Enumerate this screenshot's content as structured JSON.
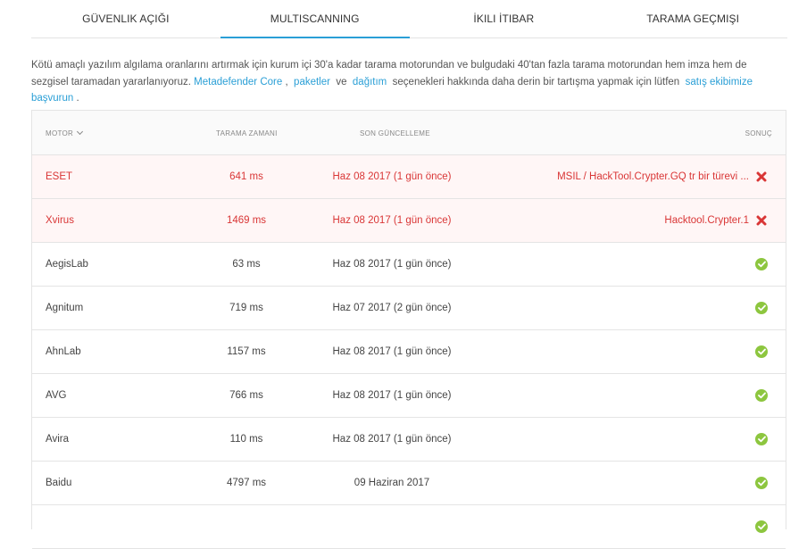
{
  "tabs": [
    {
      "label": "GÜVENLIK AÇIĞI"
    },
    {
      "label": "MULTISCANNING",
      "active": true
    },
    {
      "label": "İKILI İTIBAR"
    },
    {
      "label": "TARAMA GEÇMIŞI"
    }
  ],
  "intro": {
    "text_before": "Kötü amaçlı yazılım algılama oranlarını artırmak için kurum içi 30'a kadar tarama motorundan ve bulgudaki 40'tan fazla tarama motorundan hem imza hem de sezgisel taramadan yararlanıyoruz. ",
    "link_core": "Metadefender Core",
    "sep1": " ,  ",
    "link_packages": "paketler",
    "sep2": "  ve  ",
    "link_deploy": "dağıtım",
    "text_middle": "  seçenekleri hakkında daha derin bir tartışma yapmak için lütfen  ",
    "link_sales": "satış ekibimize başvurun",
    "text_end": " ."
  },
  "table": {
    "headers": {
      "motor": "MOTOR",
      "time": "TARAMA ZAMANI",
      "updated": "SON GÜNCELLEME",
      "result": "SONUÇ"
    },
    "rows": [
      {
        "motor": "ESET",
        "time": "641 ms",
        "updated": "Haz 08 2017 (1 gün önce)",
        "result": "MSIL / HackTool.Crypter.GQ tr bir türevi ...",
        "status": "infected"
      },
      {
        "motor": "Xvirus",
        "time": "1469 ms",
        "updated": "Haz 08 2017 (1 gün önce)",
        "result": "Hacktool.Crypter.1",
        "status": "infected"
      },
      {
        "motor": "AegisLab",
        "time": "63 ms",
        "updated": "Haz 08 2017 (1 gün önce)",
        "result": "",
        "status": "clean"
      },
      {
        "motor": "Agnitum",
        "time": "719 ms",
        "updated": "Haz 07 2017 (2 gün önce)",
        "result": "",
        "status": "clean"
      },
      {
        "motor": "AhnLab",
        "time": "1157 ms",
        "updated": "Haz 08 2017 (1 gün önce)",
        "result": "",
        "status": "clean"
      },
      {
        "motor": "AVG",
        "time": "766 ms",
        "updated": "Haz 08 2017 (1 gün önce)",
        "result": "",
        "status": "clean"
      },
      {
        "motor": "Avira",
        "time": "110 ms",
        "updated": "Haz 08 2017 (1 gün önce)",
        "result": "",
        "status": "clean"
      },
      {
        "motor": "Baidu",
        "time": "4797 ms",
        "updated": "09 Haziran 2017",
        "result": "",
        "status": "clean"
      },
      {
        "motor": "",
        "time": "",
        "updated": "",
        "result": "",
        "status": "clean"
      }
    ]
  },
  "colors": {
    "accent": "#2a9fd6",
    "infected": "#d93636",
    "clean": "#8dc63f"
  },
  "icons": {
    "clean": "check-circle-icon",
    "infected": "x-icon",
    "sort": "chevron-down-icon"
  }
}
